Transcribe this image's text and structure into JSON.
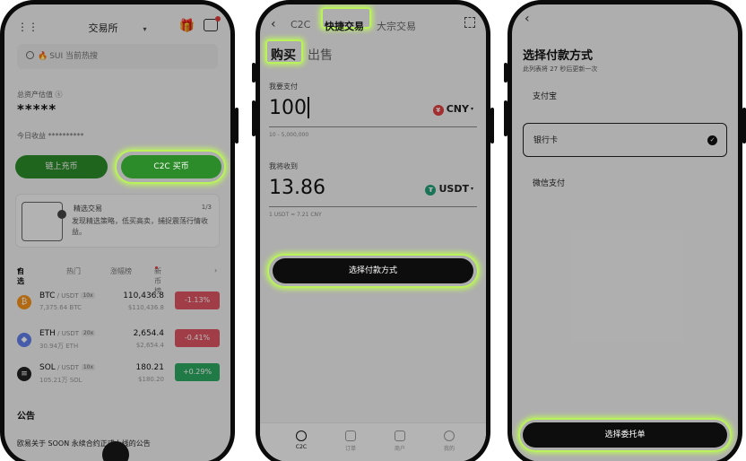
{
  "phone1": {
    "exchange_label": "交易所",
    "search_placeholder": "SUI 当前热搜",
    "assets_label": "总资产估值 ⓢ",
    "assets_value": "*****",
    "today_label": "今日收益 **********",
    "onchain_button": "链上充币",
    "c2c_button": "C2C 买币",
    "banner": {
      "title": "精选交易",
      "page": "1/3",
      "desc": "发现精选策略，低买高卖，捕捉震荡行情收益。"
    },
    "tabs": [
      "自选",
      "热门",
      "涨幅榜",
      "新币榜"
    ],
    "coins": [
      {
        "sym": "BTC",
        "pair": " / USDT",
        "lev": "10x",
        "vol": "7,375.64 BTC",
        "price": "110,436.8",
        "sub": "$110,436.8",
        "change": "-1.13%",
        "color": "#e05563",
        "icon_color": "#f7931a",
        "icon": "₿"
      },
      {
        "sym": "ETH",
        "pair": " / USDT",
        "lev": "20x",
        "vol": "30.94万 ETH",
        "price": "2,654.4",
        "sub": "$2,654.4",
        "change": "-0.41%",
        "color": "#e05563",
        "icon_color": "#627eea",
        "icon": "◆"
      },
      {
        "sym": "SOL",
        "pair": " / USDT",
        "lev": "10x",
        "vol": "105.21万 SOL",
        "price": "180.21",
        "sub": "$180.20",
        "change": "+0.29%",
        "color": "#2daa60",
        "icon_color": "#222222",
        "icon": "≡"
      }
    ],
    "announcement_title": "公告",
    "announcement_text": "欧易关于 SOON 永续合约正式上线的公告"
  },
  "phone2": {
    "tabs": [
      "C2C",
      "快捷交易",
      "大宗交易"
    ],
    "buy": "购买",
    "sell": "出售",
    "pay_label": "我要支付",
    "pay_amount": "100",
    "pay_currency": "CNY",
    "pay_range": "10 - 5,000,000",
    "receive_label": "我将收到",
    "receive_amount": "13.86",
    "receive_currency": "USDT",
    "rate": "1 USDT ≈ 7.21 CNY",
    "action_button": "选择付款方式",
    "tabbar": [
      "C2C",
      "订单",
      "商户",
      "我的"
    ]
  },
  "phone3": {
    "title": "选择付款方式",
    "subtitle": "此列表将 27 秒后更新一次",
    "options": [
      "支付宝",
      "银行卡",
      "微信支付"
    ],
    "selected": "银行卡",
    "action_button": "选择委托单"
  },
  "colors": {
    "highlight": "#b9f25a",
    "brand_green": "#2d8c2a",
    "negative": "#e05563",
    "positive": "#2daa60",
    "cny_red": "#e24040",
    "usdt_green": "#26a17b"
  }
}
